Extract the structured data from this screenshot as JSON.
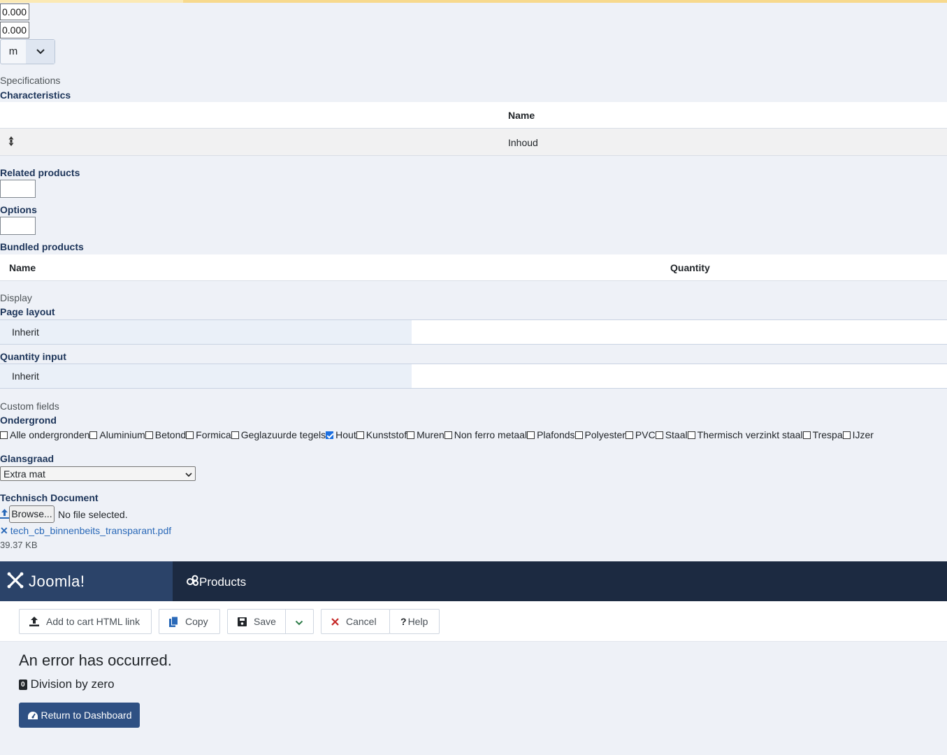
{
  "dimensions": {
    "length_value": "0.000",
    "width_value": "0.000",
    "unit_selected": "m"
  },
  "specifications": {
    "section_label": "Specifications",
    "characteristics_label": "Characteristics",
    "table_header_name": "Name",
    "rows": [
      {
        "name": "Inhoud"
      }
    ]
  },
  "related_products_label": "Related products",
  "options_label": "Options",
  "bundled": {
    "label": "Bundled products",
    "col_name": "Name",
    "col_quantity": "Quantity"
  },
  "display": {
    "section_label": "Display",
    "page_layout_label": "Page layout",
    "page_layout_value": "Inherit",
    "quantity_input_label": "Quantity input",
    "quantity_input_value": "Inherit"
  },
  "custom_fields": {
    "section_label": "Custom fields",
    "ondergrond_label": "Ondergrond",
    "ondergrond_options": [
      {
        "label": "Alle ondergronden",
        "checked": false
      },
      {
        "label": "Aluminium",
        "checked": false
      },
      {
        "label": "Betond",
        "checked": false
      },
      {
        "label": "Formica",
        "checked": false
      },
      {
        "label": "Geglazuurde tegels",
        "checked": false
      },
      {
        "label": "Hout",
        "checked": true
      },
      {
        "label": "Kunststof",
        "checked": false
      },
      {
        "label": "Muren",
        "checked": false
      },
      {
        "label": "Non ferro metaal",
        "checked": false
      },
      {
        "label": "Plafonds",
        "checked": false
      },
      {
        "label": "Polyester",
        "checked": false
      },
      {
        "label": "PVC",
        "checked": false
      },
      {
        "label": "Staal",
        "checked": false
      },
      {
        "label": "Thermisch verzinkt staal",
        "checked": false
      },
      {
        "label": "Trespa",
        "checked": false
      },
      {
        "label": "IJzer",
        "checked": false
      }
    ],
    "glansgraad_label": "Glansgraad",
    "glansgraad_value": "Extra mat",
    "technisch_label": "Technisch Document",
    "browse_label": "Browse...",
    "no_file_text": "No file selected.",
    "file_name": "tech_cb_binnenbeits_transparant.pdf",
    "file_size": "39.37 KB"
  },
  "header": {
    "logo_text": "Joomla!",
    "page_title": "Products"
  },
  "toolbar": {
    "add_to_cart": "Add to cart HTML link",
    "copy": "Copy",
    "save": "Save",
    "cancel": "Cancel",
    "help": "Help"
  },
  "error": {
    "title": "An error has occurred.",
    "code": "0",
    "message": "Division by zero",
    "return_button": "Return to Dashboard"
  },
  "colors": {
    "header_bg": "#1c2a41",
    "logo_bg": "#2b4369",
    "accent_blue": "#2e5083",
    "label_navy": "#1c3459"
  }
}
